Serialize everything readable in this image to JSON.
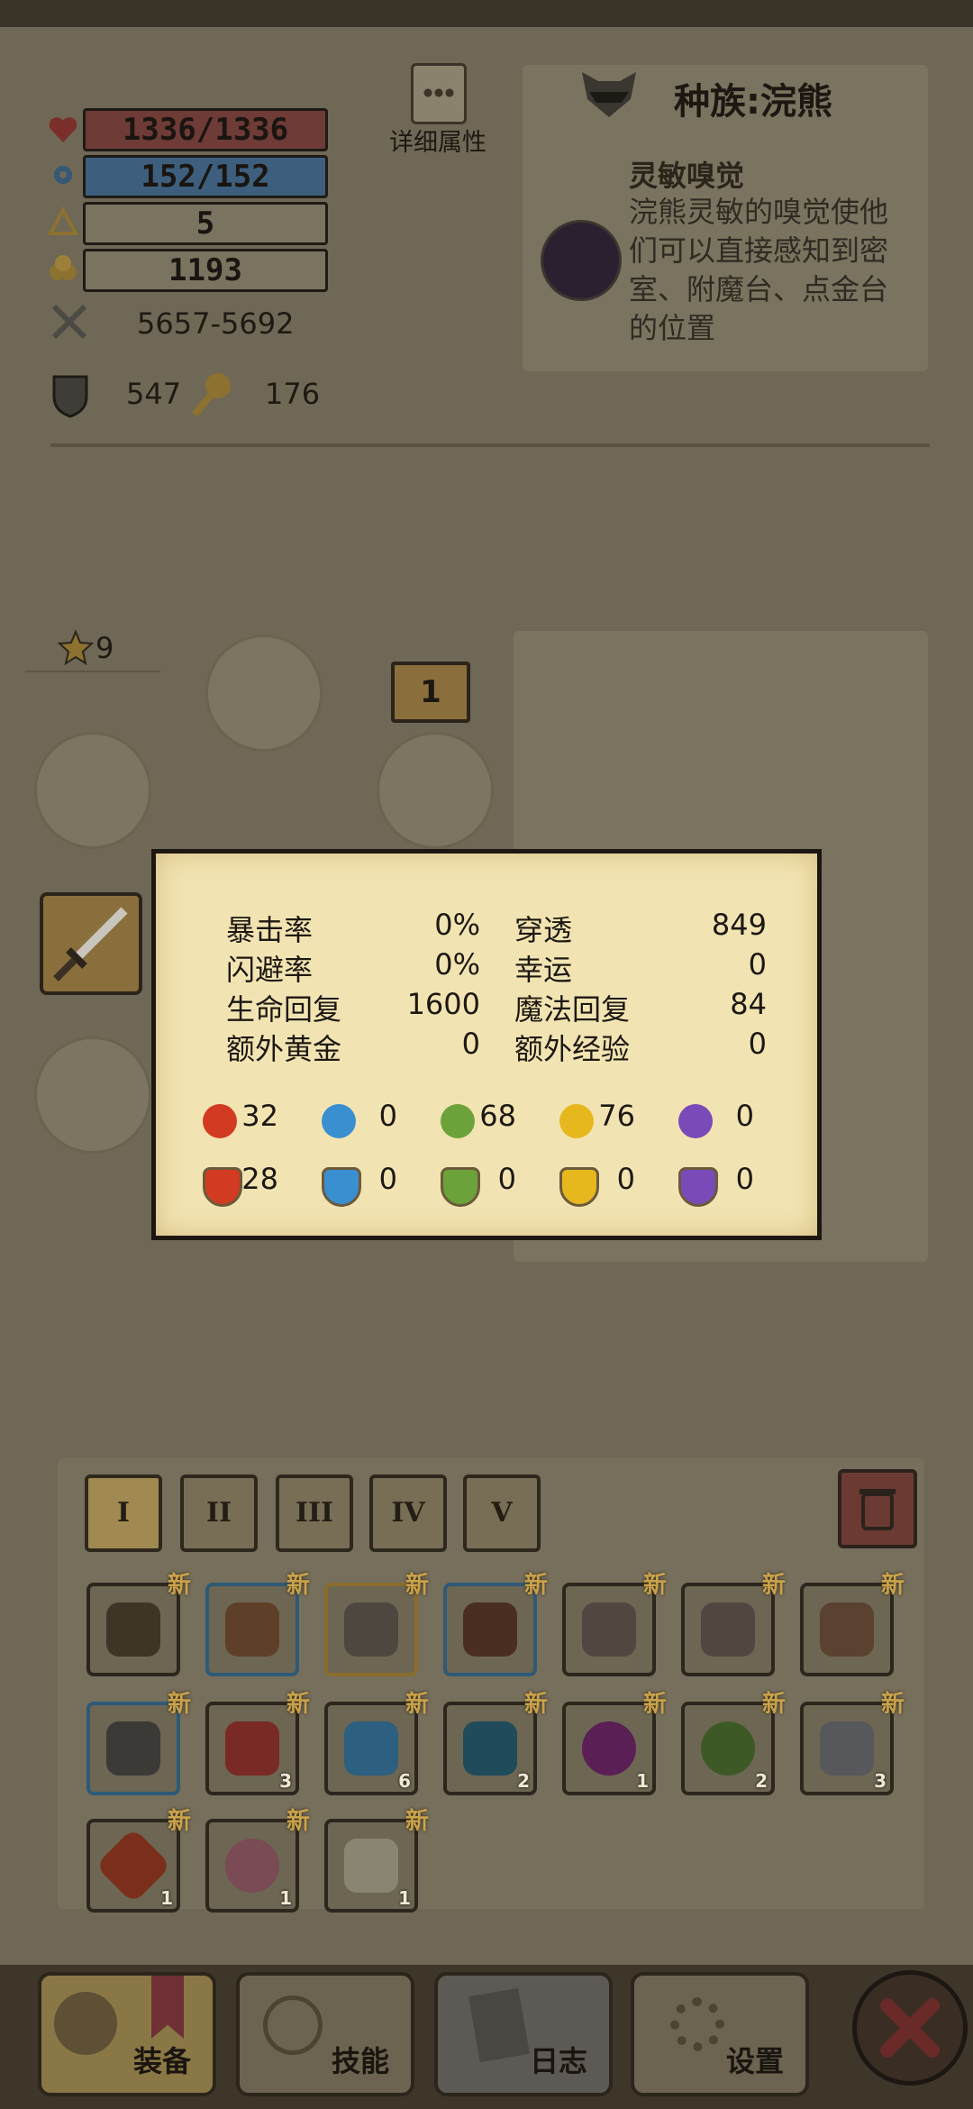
{
  "stats": {
    "hp": "1336/1336",
    "mp": "152/152",
    "level": "5",
    "gold": "1193",
    "attack": "5657-5692",
    "defense": "547",
    "magic_defense": "176",
    "detail_label": "详细属性"
  },
  "race": {
    "title": "种族:浣熊",
    "skill_name": "灵敏嗅觉",
    "skill_desc_lines": [
      "浣熊灵敏的嗅觉使他",
      "们可以直接感知到密",
      "室、附魔台、点金台",
      "的位置"
    ]
  },
  "equip": {
    "star_count": "9",
    "slot_badge": "1"
  },
  "popup": {
    "rows": [
      {
        "l_label": "暴击率",
        "l_val": "0%",
        "r_label": "穿透",
        "r_val": "849"
      },
      {
        "l_label": "闪避率",
        "l_val": "0%",
        "r_label": "幸运",
        "r_val": "0"
      },
      {
        "l_label": "生命回复",
        "l_val": "1600",
        "r_label": "魔法回复",
        "r_val": "84"
      },
      {
        "l_label": "额外黄金",
        "l_val": "0",
        "r_label": "额外经验",
        "r_val": "0"
      }
    ],
    "element_attack": [
      {
        "icon": "fire-drop-icon",
        "color": "#d23a22",
        "value": "32"
      },
      {
        "icon": "water-drop-icon",
        "color": "#3a8fd0",
        "value": "0"
      },
      {
        "icon": "leaf-icon",
        "color": "#6ca23a",
        "value": "68"
      },
      {
        "icon": "lightning-icon",
        "color": "#e6b81e",
        "value": "76"
      },
      {
        "icon": "void-orb-icon",
        "color": "#7a4ab8",
        "value": "0"
      }
    ],
    "element_resist": [
      {
        "icon": "fire-shield-icon",
        "color": "#d23a22",
        "value": "28"
      },
      {
        "icon": "water-shield-icon",
        "color": "#3a8fd0",
        "value": "0"
      },
      {
        "icon": "leaf-shield-icon",
        "color": "#6ca23a",
        "value": "0"
      },
      {
        "icon": "lightning-shield-icon",
        "color": "#e6b81e",
        "value": "0"
      },
      {
        "icon": "void-shield-icon",
        "color": "#7a4ab8",
        "value": "0"
      }
    ]
  },
  "bag": {
    "tabs": [
      "I",
      "II",
      "III",
      "IV",
      "V"
    ],
    "new_badge": "新",
    "counts": [
      "3",
      "6",
      "2",
      "1",
      "2",
      "3",
      "1",
      "1",
      "1"
    ]
  },
  "nav": {
    "equip": "装备",
    "skills": "技能",
    "log": "日志",
    "settings": "设置"
  }
}
